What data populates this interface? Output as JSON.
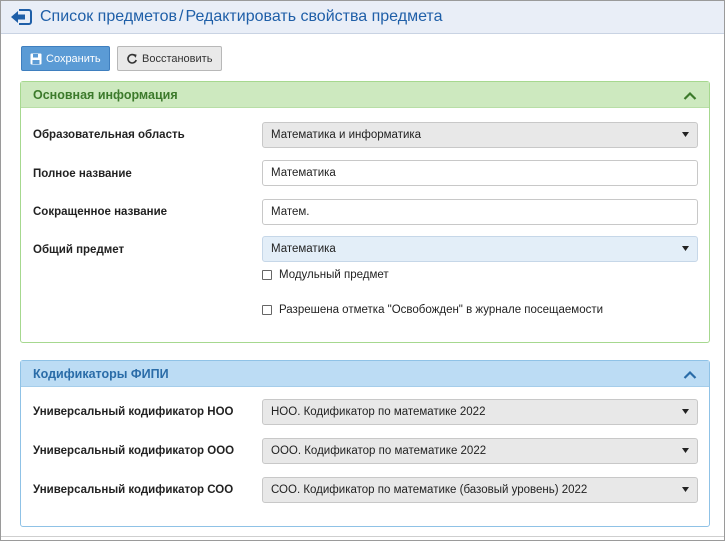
{
  "header": {
    "title_part1": "Список предметов",
    "separator": "/",
    "title_part2": "Редактировать свойства предмета",
    "back_icon": "back-arrow-icon"
  },
  "toolbar": {
    "save_label": "Сохранить",
    "restore_label": "Восстановить",
    "save_icon": "floppy-disk-icon",
    "restore_icon": "refresh-icon"
  },
  "main_info": {
    "title": "Основная информация",
    "fields": {
      "edu_area_label": "Образовательная область",
      "edu_area_value": "Математика и информатика",
      "full_name_label": "Полное название",
      "full_name_value": "Математика",
      "short_name_label": "Сокращенное название",
      "short_name_value": "Матем.",
      "common_subject_label": "Общий предмет",
      "common_subject_value": "Математика"
    },
    "checkboxes": {
      "modular_label": "Модульный предмет",
      "modular_checked": false,
      "exempt_label": "Разрешена отметка \"Освобожден\" в журнале посещаемости",
      "exempt_checked": false
    }
  },
  "fipi": {
    "title": "Кодификаторы ФИПИ",
    "fields": {
      "noo_label": "Универсальный кодификатор НОО",
      "noo_value": "НОО. Кодификатор по математике 2022",
      "ooo_label": "Универсальный кодификатор ООО",
      "ooo_value": "ООО. Кодификатор по математике 2022",
      "soo_label": "Универсальный кодификатор СОО",
      "soo_value": "СОО. Кодификатор по математике (базовый уровень) 2022"
    }
  },
  "colors": {
    "header_title": "#1f5fa8",
    "primary_button": "#5b9bd5",
    "green_panel_head": "#cde9bf",
    "blue_panel_head": "#bcdcf4"
  }
}
